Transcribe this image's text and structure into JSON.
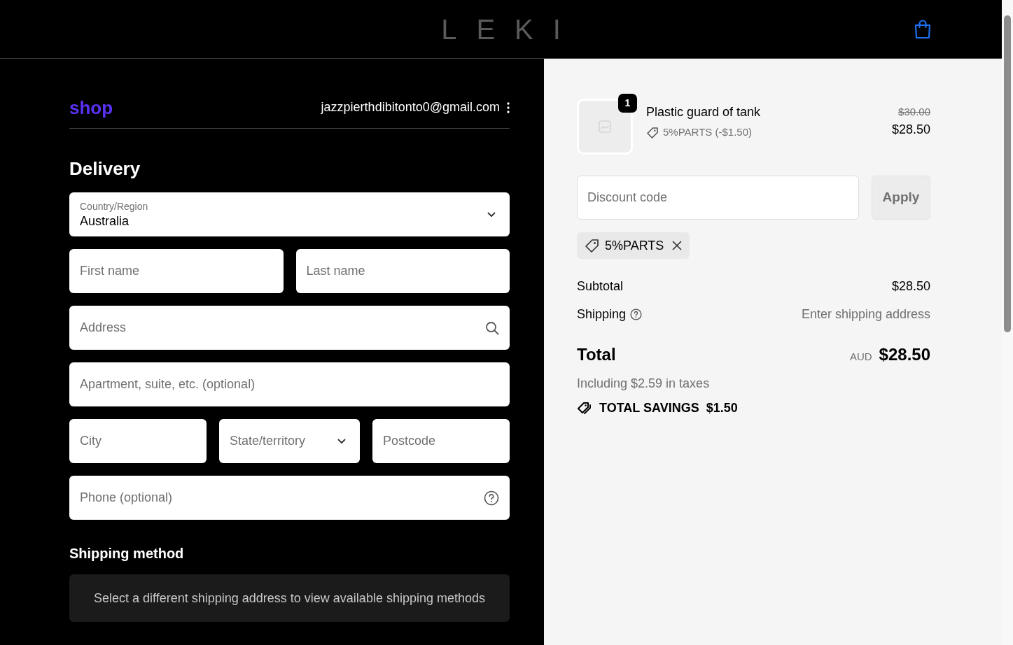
{
  "header": {
    "logo": "LEKI"
  },
  "account": {
    "shop_logo": "shop",
    "email": "jazzpierthdibitonto0@gmail.com"
  },
  "delivery": {
    "title": "Delivery",
    "rows": [
      [
        {
          "kind": "select",
          "label": "Country/Region",
          "value": "Australia"
        }
      ],
      [
        {
          "kind": "text",
          "placeholder": "First name"
        },
        {
          "kind": "text",
          "placeholder": "Last name"
        }
      ],
      [
        {
          "kind": "search",
          "placeholder": "Address"
        }
      ],
      [
        {
          "kind": "text",
          "placeholder": "Apartment, suite, etc. (optional)"
        }
      ],
      [
        {
          "kind": "text",
          "placeholder": "City"
        },
        {
          "kind": "select",
          "placeholder": "State/territory"
        },
        {
          "kind": "text",
          "placeholder": "Postcode"
        }
      ],
      [
        {
          "kind": "phone",
          "placeholder": "Phone (optional)"
        }
      ]
    ]
  },
  "shipping_method": {
    "title": "Shipping method",
    "notice": "Select a different shipping address to view available shipping methods"
  },
  "summary": {
    "items": [
      {
        "quantity": "1",
        "name": "Plastic guard of tank",
        "discount": "5%PARTS (-$1.50)",
        "original_price": "$30.00",
        "price": "$28.50"
      }
    ],
    "discount_field": {
      "placeholder": "Discount code"
    },
    "apply_button": "Apply",
    "applied_codes": [
      "5%PARTS"
    ],
    "lines": [
      {
        "kind": "amount",
        "label": "Subtotal",
        "value": "$28.50",
        "help": false
      },
      {
        "kind": "note",
        "label": "Shipping",
        "value": "Enter shipping address",
        "help": true
      }
    ],
    "total": {
      "label": "Total",
      "currency": "AUD",
      "amount": "$28.50",
      "taxes": "Including $2.59 in taxes",
      "savings_label": "TOTAL SAVINGS",
      "savings_amount": "$1.50"
    }
  }
}
